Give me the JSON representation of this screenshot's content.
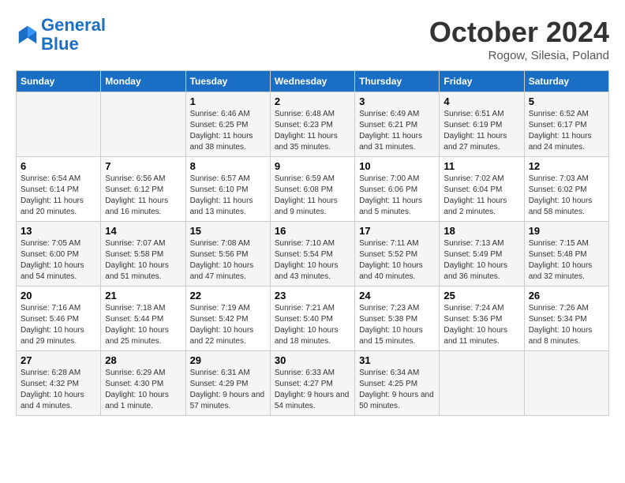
{
  "header": {
    "logo_line1": "General",
    "logo_line2": "Blue",
    "month_title": "October 2024",
    "location": "Rogow, Silesia, Poland"
  },
  "weekdays": [
    "Sunday",
    "Monday",
    "Tuesday",
    "Wednesday",
    "Thursday",
    "Friday",
    "Saturday"
  ],
  "weeks": [
    [
      {
        "day": "",
        "sunrise": "",
        "sunset": "",
        "daylight": ""
      },
      {
        "day": "",
        "sunrise": "",
        "sunset": "",
        "daylight": ""
      },
      {
        "day": "1",
        "sunrise": "Sunrise: 6:46 AM",
        "sunset": "Sunset: 6:25 PM",
        "daylight": "Daylight: 11 hours and 38 minutes."
      },
      {
        "day": "2",
        "sunrise": "Sunrise: 6:48 AM",
        "sunset": "Sunset: 6:23 PM",
        "daylight": "Daylight: 11 hours and 35 minutes."
      },
      {
        "day": "3",
        "sunrise": "Sunrise: 6:49 AM",
        "sunset": "Sunset: 6:21 PM",
        "daylight": "Daylight: 11 hours and 31 minutes."
      },
      {
        "day": "4",
        "sunrise": "Sunrise: 6:51 AM",
        "sunset": "Sunset: 6:19 PM",
        "daylight": "Daylight: 11 hours and 27 minutes."
      },
      {
        "day": "5",
        "sunrise": "Sunrise: 6:52 AM",
        "sunset": "Sunset: 6:17 PM",
        "daylight": "Daylight: 11 hours and 24 minutes."
      }
    ],
    [
      {
        "day": "6",
        "sunrise": "Sunrise: 6:54 AM",
        "sunset": "Sunset: 6:14 PM",
        "daylight": "Daylight: 11 hours and 20 minutes."
      },
      {
        "day": "7",
        "sunrise": "Sunrise: 6:56 AM",
        "sunset": "Sunset: 6:12 PM",
        "daylight": "Daylight: 11 hours and 16 minutes."
      },
      {
        "day": "8",
        "sunrise": "Sunrise: 6:57 AM",
        "sunset": "Sunset: 6:10 PM",
        "daylight": "Daylight: 11 hours and 13 minutes."
      },
      {
        "day": "9",
        "sunrise": "Sunrise: 6:59 AM",
        "sunset": "Sunset: 6:08 PM",
        "daylight": "Daylight: 11 hours and 9 minutes."
      },
      {
        "day": "10",
        "sunrise": "Sunrise: 7:00 AM",
        "sunset": "Sunset: 6:06 PM",
        "daylight": "Daylight: 11 hours and 5 minutes."
      },
      {
        "day": "11",
        "sunrise": "Sunrise: 7:02 AM",
        "sunset": "Sunset: 6:04 PM",
        "daylight": "Daylight: 11 hours and 2 minutes."
      },
      {
        "day": "12",
        "sunrise": "Sunrise: 7:03 AM",
        "sunset": "Sunset: 6:02 PM",
        "daylight": "Daylight: 10 hours and 58 minutes."
      }
    ],
    [
      {
        "day": "13",
        "sunrise": "Sunrise: 7:05 AM",
        "sunset": "Sunset: 6:00 PM",
        "daylight": "Daylight: 10 hours and 54 minutes."
      },
      {
        "day": "14",
        "sunrise": "Sunrise: 7:07 AM",
        "sunset": "Sunset: 5:58 PM",
        "daylight": "Daylight: 10 hours and 51 minutes."
      },
      {
        "day": "15",
        "sunrise": "Sunrise: 7:08 AM",
        "sunset": "Sunset: 5:56 PM",
        "daylight": "Daylight: 10 hours and 47 minutes."
      },
      {
        "day": "16",
        "sunrise": "Sunrise: 7:10 AM",
        "sunset": "Sunset: 5:54 PM",
        "daylight": "Daylight: 10 hours and 43 minutes."
      },
      {
        "day": "17",
        "sunrise": "Sunrise: 7:11 AM",
        "sunset": "Sunset: 5:52 PM",
        "daylight": "Daylight: 10 hours and 40 minutes."
      },
      {
        "day": "18",
        "sunrise": "Sunrise: 7:13 AM",
        "sunset": "Sunset: 5:49 PM",
        "daylight": "Daylight: 10 hours and 36 minutes."
      },
      {
        "day": "19",
        "sunrise": "Sunrise: 7:15 AM",
        "sunset": "Sunset: 5:48 PM",
        "daylight": "Daylight: 10 hours and 32 minutes."
      }
    ],
    [
      {
        "day": "20",
        "sunrise": "Sunrise: 7:16 AM",
        "sunset": "Sunset: 5:46 PM",
        "daylight": "Daylight: 10 hours and 29 minutes."
      },
      {
        "day": "21",
        "sunrise": "Sunrise: 7:18 AM",
        "sunset": "Sunset: 5:44 PM",
        "daylight": "Daylight: 10 hours and 25 minutes."
      },
      {
        "day": "22",
        "sunrise": "Sunrise: 7:19 AM",
        "sunset": "Sunset: 5:42 PM",
        "daylight": "Daylight: 10 hours and 22 minutes."
      },
      {
        "day": "23",
        "sunrise": "Sunrise: 7:21 AM",
        "sunset": "Sunset: 5:40 PM",
        "daylight": "Daylight: 10 hours and 18 minutes."
      },
      {
        "day": "24",
        "sunrise": "Sunrise: 7:23 AM",
        "sunset": "Sunset: 5:38 PM",
        "daylight": "Daylight: 10 hours and 15 minutes."
      },
      {
        "day": "25",
        "sunrise": "Sunrise: 7:24 AM",
        "sunset": "Sunset: 5:36 PM",
        "daylight": "Daylight: 10 hours and 11 minutes."
      },
      {
        "day": "26",
        "sunrise": "Sunrise: 7:26 AM",
        "sunset": "Sunset: 5:34 PM",
        "daylight": "Daylight: 10 hours and 8 minutes."
      }
    ],
    [
      {
        "day": "27",
        "sunrise": "Sunrise: 6:28 AM",
        "sunset": "Sunset: 4:32 PM",
        "daylight": "Daylight: 10 hours and 4 minutes."
      },
      {
        "day": "28",
        "sunrise": "Sunrise: 6:29 AM",
        "sunset": "Sunset: 4:30 PM",
        "daylight": "Daylight: 10 hours and 1 minute."
      },
      {
        "day": "29",
        "sunrise": "Sunrise: 6:31 AM",
        "sunset": "Sunset: 4:29 PM",
        "daylight": "Daylight: 9 hours and 57 minutes."
      },
      {
        "day": "30",
        "sunrise": "Sunrise: 6:33 AM",
        "sunset": "Sunset: 4:27 PM",
        "daylight": "Daylight: 9 hours and 54 minutes."
      },
      {
        "day": "31",
        "sunrise": "Sunrise: 6:34 AM",
        "sunset": "Sunset: 4:25 PM",
        "daylight": "Daylight: 9 hours and 50 minutes."
      },
      {
        "day": "",
        "sunrise": "",
        "sunset": "",
        "daylight": ""
      },
      {
        "day": "",
        "sunrise": "",
        "sunset": "",
        "daylight": ""
      }
    ]
  ]
}
